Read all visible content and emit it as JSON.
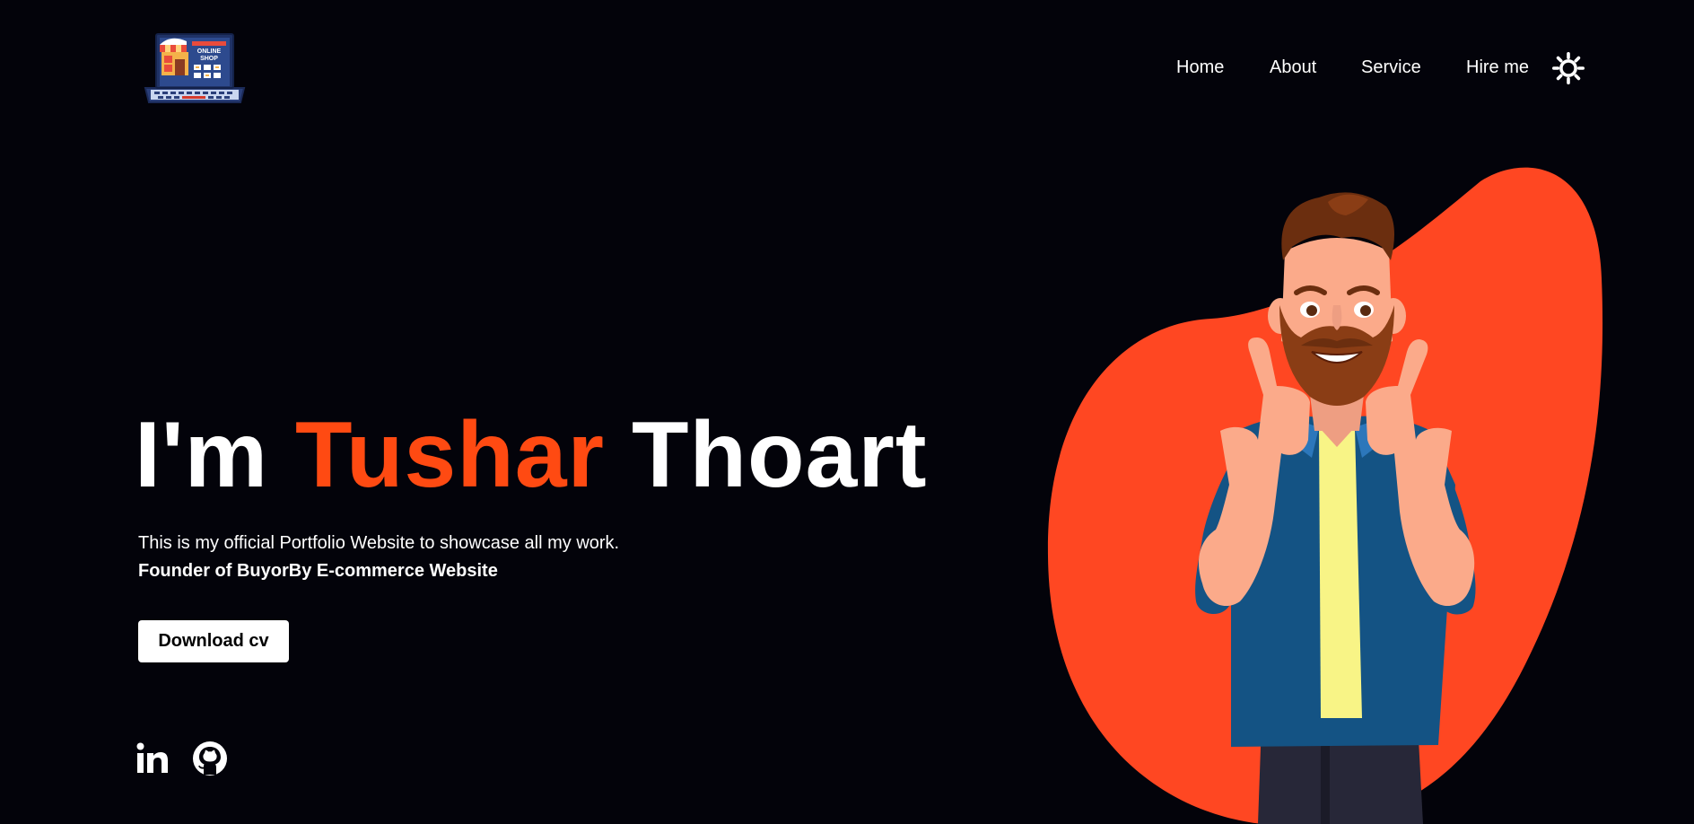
{
  "header": {
    "logo": {
      "icon": "online-shop-logo",
      "text_line1": "ONLINE",
      "text_line2": "SHOP"
    },
    "nav": [
      {
        "label": "Home"
      },
      {
        "label": "About"
      },
      {
        "label": "Service"
      },
      {
        "label": "Hire me"
      }
    ],
    "theme_toggle_icon": "sun-icon"
  },
  "hero": {
    "title_prefix": "I'm",
    "title_first_name": "Tushar",
    "title_last_name": "Thoart",
    "description": "This is my official Portfolio Website to showcase all my work.",
    "founder_line": "Founder of BuyorBy E-commerce Website",
    "download_button_label": "Download cv",
    "social_icons": [
      "linkedin-icon",
      "github-icon"
    ],
    "illustration": "cartoon-man-thumbs-up"
  },
  "colors": {
    "background": "#03030a",
    "accent": "#ff4a12",
    "blob": "#ff4722",
    "text": "#ffffff",
    "button_bg": "#ffffff",
    "button_text": "#000000"
  }
}
